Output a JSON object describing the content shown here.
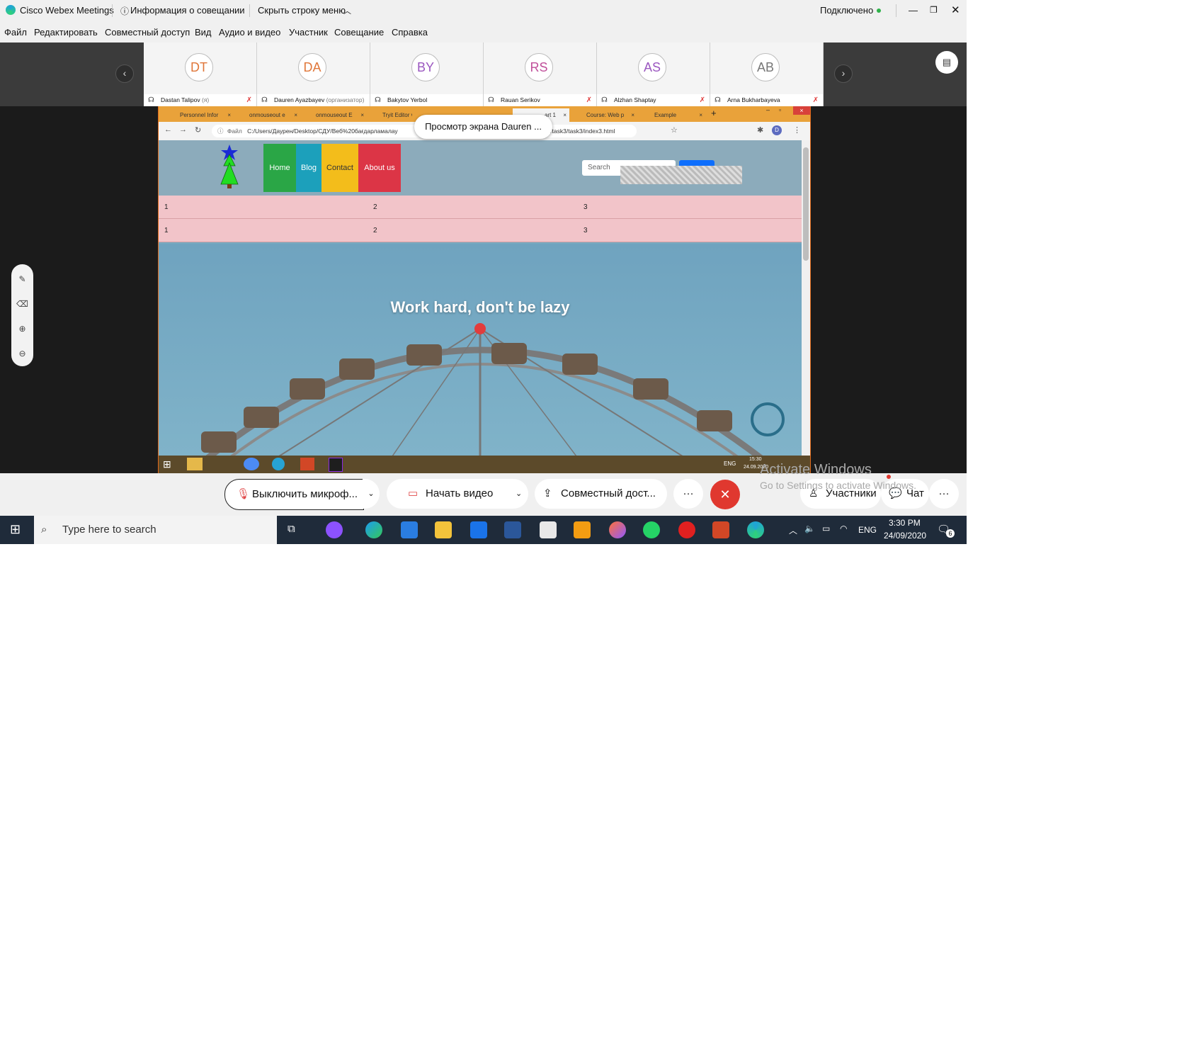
{
  "webex": {
    "app_title": "Cisco Webex Meetings",
    "meeting_info": "Информация о совещании",
    "hide_menu": "Скрыть строку меню",
    "status": "Подключено",
    "menu": [
      "Файл",
      "Редактировать",
      "Совместный доступ",
      "Вид",
      "Аудио и видео",
      "Участник",
      "Совещание",
      "Справка"
    ]
  },
  "participants": [
    {
      "initials": "DT",
      "name": "Dastan Talipov",
      "suffix": "(я)",
      "color": "#e0773a"
    },
    {
      "initials": "DA",
      "name": "Dauren Ayazbayev",
      "suffix": "(организатор)",
      "color": "#e0773a"
    },
    {
      "initials": "BY",
      "name": "Bakytov Yerbol",
      "suffix": "",
      "color": "#9b57c0"
    },
    {
      "initials": "RS",
      "name": "Rauan Serikov",
      "suffix": "",
      "color": "#c04f9a"
    },
    {
      "initials": "AS",
      "name": "Alzhan Shaptay",
      "suffix": "",
      "color": "#9b57c0"
    },
    {
      "initials": "AB",
      "name": "Arna Bukharbayeva",
      "suffix": "",
      "color": "#777777"
    }
  ],
  "shared_screen": {
    "viewing_label": "Просмотр экрана Dauren ...",
    "tabs": [
      "Personnel Infor",
      "onmouseout e",
      "onmouseout E",
      "Tryit Editor v",
      "art 1",
      "Course: Web p",
      "Example"
    ],
    "url_prefix": "Файл",
    "url_left": "C:/Users/Даурен/Desktop/СДУ/Веб%20бағдарламалау",
    "url_right": "20-2021/task3/task3/index3.html",
    "avatar_letter": "D",
    "nav": [
      "Home",
      "Blog",
      "Contact",
      "About us"
    ],
    "search_placeholder": "Search",
    "table_rows": [
      [
        "1",
        "2",
        "3"
      ],
      [
        "1",
        "2",
        "3"
      ]
    ],
    "hero_text": "Work hard, don't be lazy",
    "guest_clock_time": "15:30",
    "guest_clock_date": "24.09.2020",
    "guest_lang": "ENG"
  },
  "controls": {
    "mute": "Выключить микроф...",
    "video": "Начать видео",
    "share": "Совместный дост...",
    "participants": "Участники",
    "chat": "Чат",
    "more": "···"
  },
  "watermark": {
    "title": "Activate Windows",
    "subtitle": "Go to Settings to activate Windows."
  },
  "taskbar": {
    "search_placeholder": "Type here to search",
    "lang": "ENG",
    "time": "3:30 PM",
    "date": "24/09/2020",
    "notifications": "6"
  }
}
